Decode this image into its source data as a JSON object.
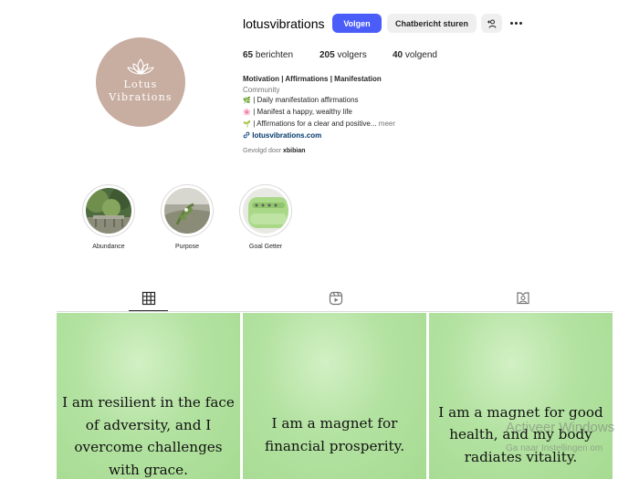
{
  "profile": {
    "username": "lotusvibrations",
    "avatar_text_1": "Lotus",
    "avatar_text_2": "Vibrations",
    "avatar_color": "#c8ada1",
    "buttons": {
      "follow": "Volgen",
      "message": "Chatbericht sturen",
      "suggest_icon": "add-person-icon",
      "more_icon": "more-horizontal-icon"
    },
    "stats": {
      "posts_count": "65",
      "posts_label": "berichten",
      "followers_count": "205",
      "followers_label": "volgers",
      "following_count": "40",
      "following_label": "volgend"
    },
    "bio": {
      "name": "Motivation | Affirmations | Manifestation",
      "category": "Community",
      "line1_emoji": "🌿",
      "line1": " | Daily manifestation affirmations",
      "line2_emoji": "🌸",
      "line2": " | Manifest a happy, wealthy life",
      "line3_emoji": "🌱",
      "line3": " | Affirmations for a clear and positive...",
      "more": "meer",
      "link_icon": "link-icon",
      "link": "lotusvibrations.com"
    },
    "followed_by_prefix": "Gevolgd door",
    "followed_by_user": "xbibian"
  },
  "highlights": [
    {
      "label": "Abundance"
    },
    {
      "label": "Purpose"
    },
    {
      "label": "Goal Getter"
    }
  ],
  "tabs": [
    {
      "icon": "grid-icon",
      "active": true
    },
    {
      "icon": "reels-icon",
      "active": false
    },
    {
      "icon": "tagged-icon",
      "active": false
    }
  ],
  "posts": [
    {
      "lines": [
        "I am resilient in the face",
        "of adversity, and I",
        "overcome challenges",
        "with grace."
      ]
    },
    {
      "lines": [
        "I am a magnet for",
        "financial prosperity."
      ]
    },
    {
      "lines": [
        "I am a magnet for good",
        "health, and my body",
        "radiates vitality."
      ]
    }
  ],
  "watermark": {
    "line1": "Activeer Windows",
    "line2": "Ga naar Instellingen om"
  },
  "colors": {
    "accent": "#4a5df9",
    "secondary_button": "#efefef",
    "post_green": "#b3e2a1",
    "link": "#00376b"
  }
}
